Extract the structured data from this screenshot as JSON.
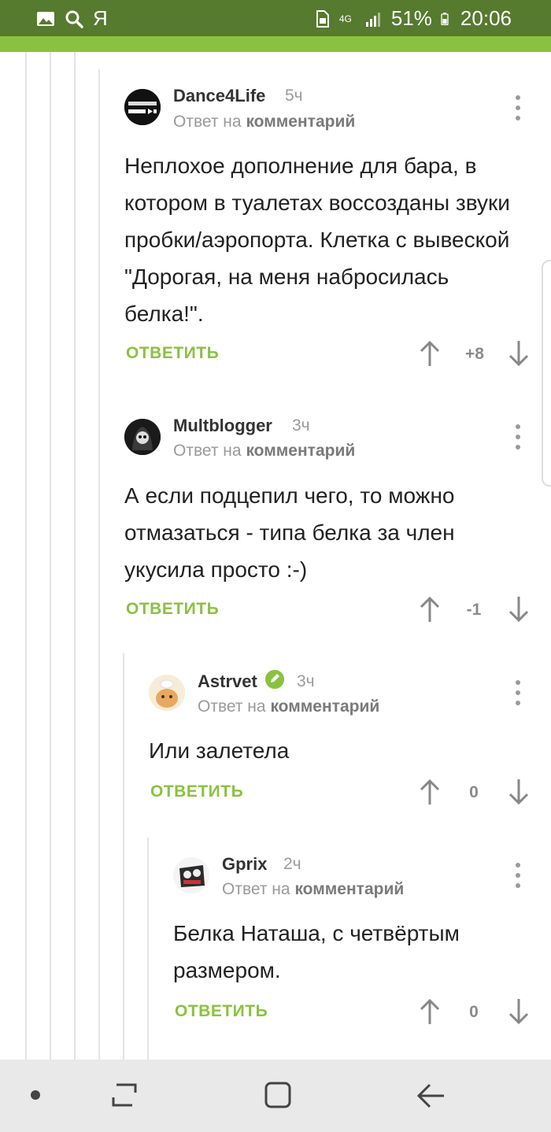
{
  "status_bar": {
    "carrier_glyph": "Я",
    "network": "4G",
    "battery": "51%",
    "time": "20:06",
    "icons": [
      "image-icon",
      "search-icon",
      "sim-icon",
      "signal-icon",
      "battery-icon"
    ]
  },
  "comments": [
    {
      "author": "Dance4Life",
      "time": "5ч",
      "reply_prefix": "Ответ на",
      "reply_link": "комментарий",
      "body": "Неплохое дополнение для бара, в котором в туалетах воссозданы звуки пробки/аэропорта. Клетка с вывеской \"Дорогая, на меня набросилась белка!\".",
      "reply_label": "ОТВЕТИТЬ",
      "score": "+8"
    },
    {
      "author": "Multblogger",
      "time": "3ч",
      "reply_prefix": "Ответ на",
      "reply_link": "комментарий",
      "body": "А если подцепил чего, то можно отмазаться - типа белка за член укусила просто :-)",
      "reply_label": "ОТВЕТИТЬ",
      "score": "-1"
    },
    {
      "author": "Astrvet",
      "time": "3ч",
      "reply_prefix": "Ответ на",
      "reply_link": "комментарий",
      "body": "Или залетела",
      "reply_label": "ОТВЕТИТЬ",
      "score": "0"
    },
    {
      "author": "Gprix",
      "time": "2ч",
      "reply_prefix": "Ответ на",
      "reply_link": "комментарий",
      "body": "Белка Наташа, с четвёртым размером.",
      "reply_label": "ОТВЕТИТЬ",
      "score": "0"
    }
  ],
  "colors": {
    "status_bar": "#567a2e",
    "accent_green": "#8ac240",
    "nav_bar": "#e9e9e9"
  },
  "nav_bar": [
    "dot-icon",
    "recent-apps-icon",
    "home-icon",
    "back-icon"
  ]
}
